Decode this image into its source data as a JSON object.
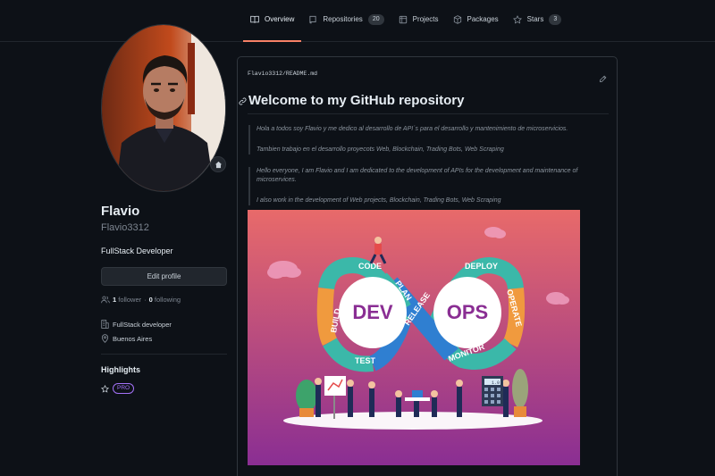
{
  "nav": {
    "tabs": [
      {
        "label": "Overview",
        "icon": "book-icon",
        "active": true
      },
      {
        "label": "Repositories",
        "icon": "repo-icon",
        "count": "20"
      },
      {
        "label": "Projects",
        "icon": "table-icon"
      },
      {
        "label": "Packages",
        "icon": "package-icon"
      },
      {
        "label": "Stars",
        "icon": "star-icon",
        "count": "3"
      }
    ]
  },
  "profile": {
    "fullname": "Flavio",
    "username": "Flavio3312",
    "bio": "FullStack Developer",
    "edit_label": "Edit profile",
    "followers": "1",
    "followers_label": "follower",
    "separator": "·",
    "following": "0",
    "following_label": "following",
    "company": "FullStack developer",
    "location": "Buenos Aires",
    "highlights_title": "Highlights",
    "pro_label": "PRO"
  },
  "readme": {
    "path_user": "Flavio3312",
    "path_sep": "/",
    "path_file": "README.md",
    "title": "Welcome to my GitHub repository",
    "es_1": "Hola a todos soy Flavio y me dedico al desarrollo de API´s para el desarrollo y mantenimiento de microservicios.",
    "es_2": "Tambien trabajo en el desarrollo proyecots Web, Blockchain, Trading Bots, Web Scraping",
    "en_1": "Hello everyone, I am Flavio and I am dedicated to the development of APIs for the development and maintenance of microservices.",
    "en_2": "I also work in the development of Web projects, Blockchain, Trading Bots, Web Scraping"
  },
  "banner": {
    "dev": "DEV",
    "ops": "OPS",
    "code": "CODE",
    "plan": "PLAN",
    "release": "RELEASE",
    "deploy": "DEPLOY",
    "build": "BUILD",
    "test": "TEST",
    "operate": "OPERATE",
    "monitor": "MONITOR",
    "calc_display": "1.0"
  },
  "colors": {
    "accent": "#f78166",
    "pro": "#a371f7",
    "banner_top": "#e86a6a",
    "banner_bottom": "#8a2e93",
    "loop_teal": "#3bb8a9",
    "loop_blue": "#2f7fd1",
    "loop_orange": "#f09a3e"
  }
}
